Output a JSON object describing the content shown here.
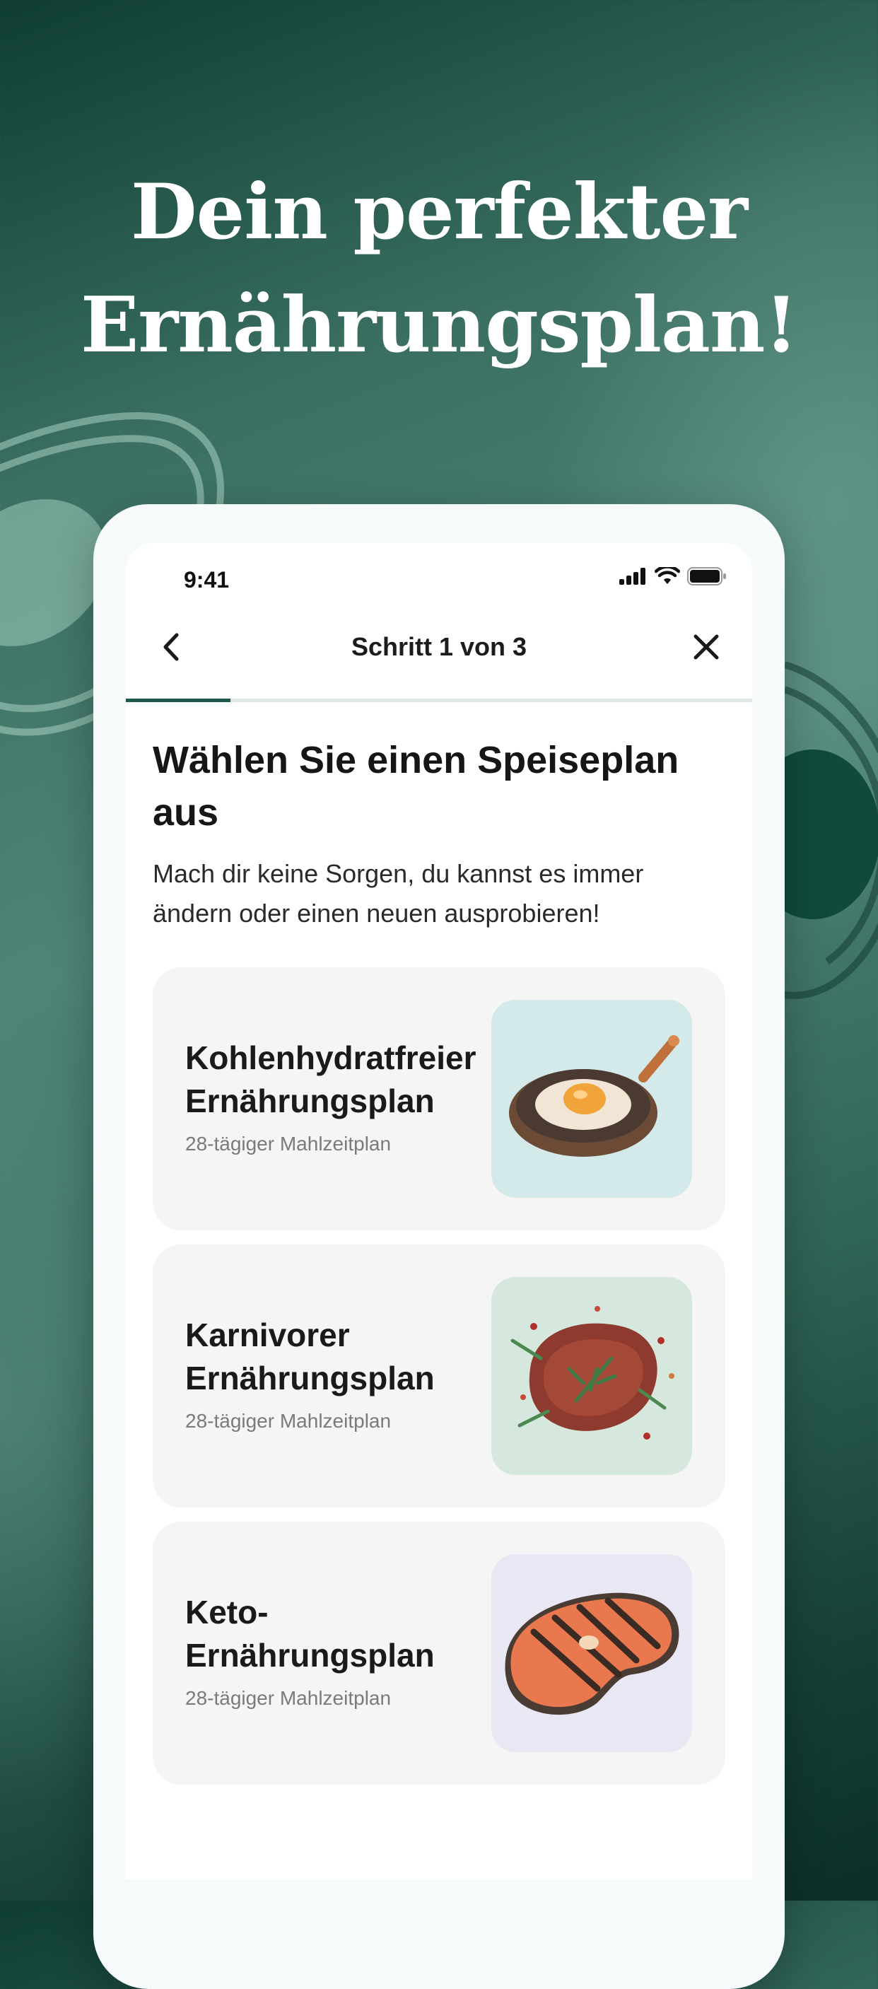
{
  "headline": {
    "line1": "Dein perfekter",
    "line2": "Ernährungsplan!"
  },
  "status_bar": {
    "time": "9:41",
    "icons": [
      "cellular-signal-icon",
      "wifi-icon",
      "battery-icon"
    ]
  },
  "nav": {
    "title": "Schritt 1 von 3",
    "back_icon": "chevron-left-icon",
    "close_icon": "close-icon"
  },
  "progress": {
    "current_step": 1,
    "total_steps": 3,
    "fraction": 0.167
  },
  "page": {
    "heading": "Wählen Sie einen Speiseplan aus",
    "subheading": "Mach dir keine Sorgen, du kannst es immer ändern oder einen neuen ausprobieren!"
  },
  "plans": [
    {
      "title_line1": "Kohlenhydratfreier",
      "title_line2": "Ernährungsplan",
      "meta": "28-tägiger Mahlzeitplan",
      "image_icon": "fried-egg-pan-icon",
      "image_bg": "#d3e9ea"
    },
    {
      "title_line1": "Karnivorer",
      "title_line2": "Ernährungsplan",
      "meta": "28-tägiger Mahlzeitplan",
      "image_icon": "steak-icon",
      "image_bg": "#d6e8dd"
    },
    {
      "title_line1": "Keto-",
      "title_line2": "Ernährungsplan",
      "meta": "28-tägiger Mahlzeitplan",
      "image_icon": "salmon-steak-icon",
      "image_bg": "#e8e8f5"
    }
  ],
  "colors": {
    "accent": "#1e5a4b",
    "background_dark": "#0f3d33",
    "card_bg": "#f5f5f5"
  }
}
